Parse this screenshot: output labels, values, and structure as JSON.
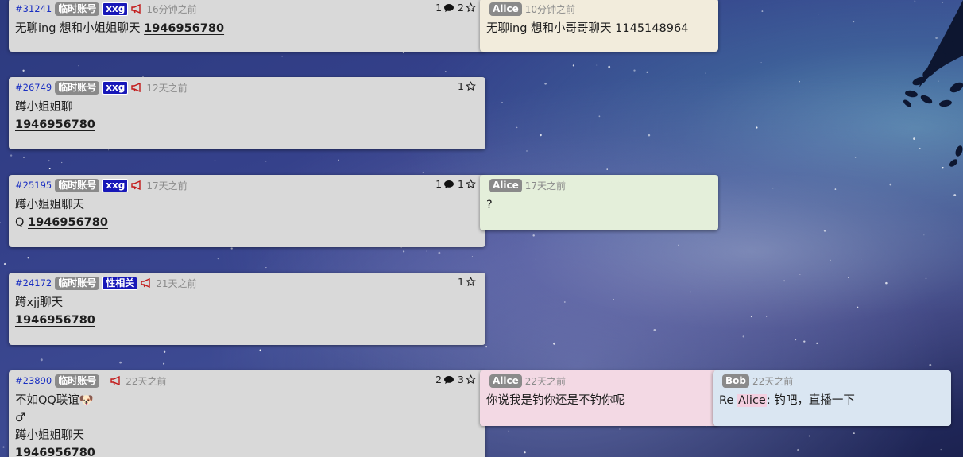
{
  "posts": [
    {
      "id": "#31241",
      "badge": "临时账号",
      "tag": "xxg",
      "time": "16分钟之前",
      "comments": "1",
      "stars": "2",
      "lines": [
        {
          "text": "无聊ing 想和小姐姐聊天 ",
          "bold": "1946956780"
        }
      ]
    },
    {
      "id": "#26749",
      "badge": "临时账号",
      "tag": "xxg",
      "time": "12天之前",
      "stars": "1",
      "lines": [
        {
          "text": "蹲小姐姐聊"
        },
        {
          "text": "",
          "bold": "1946956780"
        }
      ]
    },
    {
      "id": "#25195",
      "badge": "临时账号",
      "tag": "xxg",
      "time": "17天之前",
      "comments": "1",
      "stars": "1",
      "lines": [
        {
          "text": "蹲小姐姐聊天"
        },
        {
          "text": "Q ",
          "bold": "1946956780"
        }
      ]
    },
    {
      "id": "#24172",
      "badge": "临时账号",
      "tag": "性相关",
      "time": "21天之前",
      "stars": "1",
      "lines": [
        {
          "text": "蹲xjj聊天"
        },
        {
          "text": "",
          "bold": "1946956780"
        }
      ]
    },
    {
      "id": "#23890",
      "badge": "临时账号",
      "time": "22天之前",
      "comments": "2",
      "stars": "3",
      "lines": [
        {
          "text": "不如QQ联谊🐶"
        },
        {
          "text": "♂"
        },
        {
          "text": "蹲小姐姐聊天"
        },
        {
          "text": "",
          "bold": "1946956780"
        }
      ]
    }
  ],
  "replies": [
    {
      "author": "Alice",
      "time": "10分钟之前",
      "text": "无聊ing 想和小哥哥聊天 1145148964",
      "color": "#f2ecdc"
    },
    {
      "author": "Alice",
      "time": "17天之前",
      "text": "?",
      "color": "#e4efda"
    },
    {
      "author": "Alice",
      "time": "22天之前",
      "text": "你说我是钓你还是不钓你呢",
      "color": "#f3d9e4"
    },
    {
      "author": "Bob",
      "time": "22天之前",
      "prefix": "Re ",
      "ref": "Alice",
      "text": ": 钓吧，直播一下",
      "color": "#dae6f2"
    }
  ],
  "icons": {
    "comment": "speech-bubble-icon",
    "star": "star-outline-icon",
    "announce": "megaphone-icon"
  },
  "colors": {
    "post_id": "#1a2fc2",
    "tag": "#1717b8",
    "badge": "#8a8a8a"
  }
}
